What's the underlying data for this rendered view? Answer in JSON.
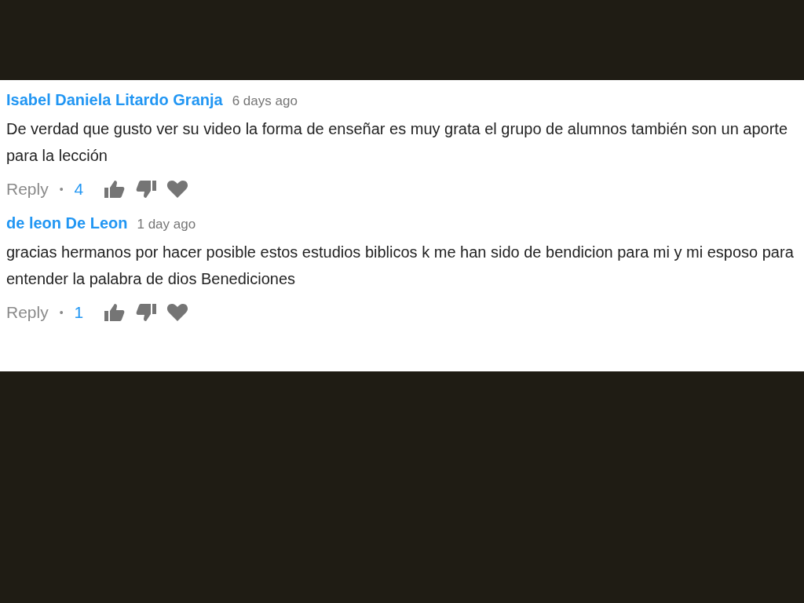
{
  "comments": [
    {
      "author": "Isabel Daniela Litardo Granja",
      "time": "6 days ago",
      "text": "De verdad que gusto ver su video la forma de enseñar es muy grata el grupo de alumnos también son un aporte para la lección",
      "reply": "Reply",
      "separator": "•",
      "likes": "4"
    },
    {
      "author": "de leon De Leon",
      "time": "1 day ago",
      "text": "gracias hermanos por hacer posible estos estudios biblicos k me han sido de bendicion para mi y mi esposo para entender la palabra de dios Benediciones",
      "reply": "Reply",
      "separator": "•",
      "likes": "1"
    }
  ]
}
